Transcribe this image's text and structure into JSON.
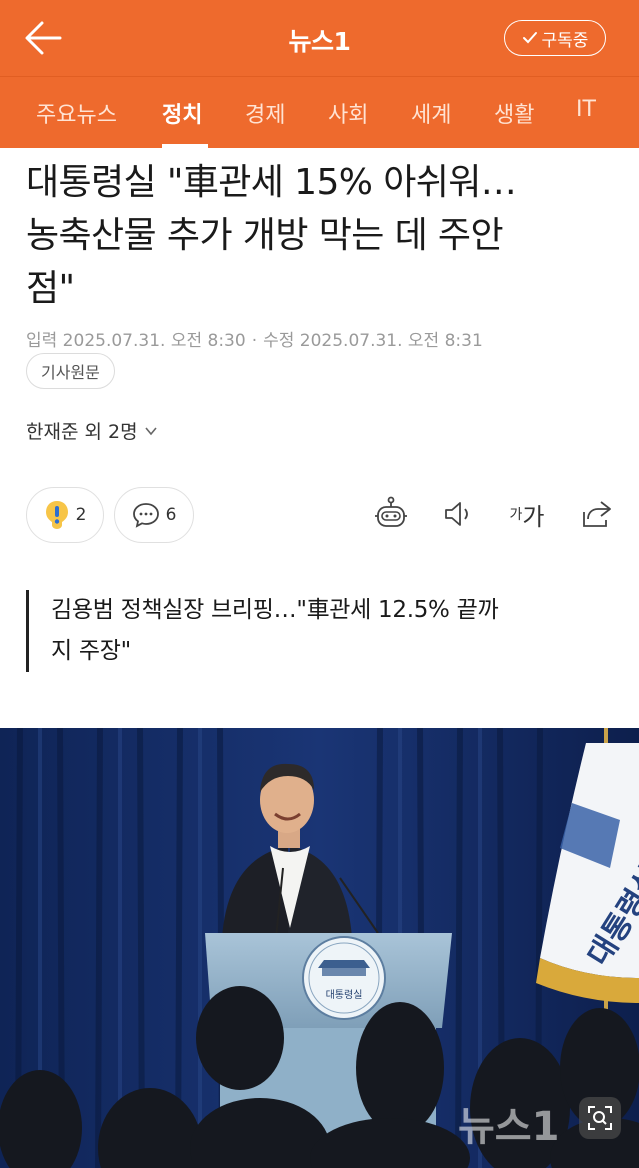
{
  "header": {
    "brand": "뉴스1",
    "subscribe_label": "구독중"
  },
  "tabs": [
    {
      "label": "주요뉴스",
      "active": false
    },
    {
      "label": "정치",
      "active": true
    },
    {
      "label": "경제",
      "active": false
    },
    {
      "label": "사회",
      "active": false
    },
    {
      "label": "세계",
      "active": false
    },
    {
      "label": "생활",
      "active": false
    },
    {
      "label": "IT",
      "active": false
    }
  ],
  "article": {
    "headline_lines": [
      "대통령실 \"車관세 15% 아쉬워…",
      "농축산물 추가 개방 막는 데 주안",
      "점\""
    ],
    "published": "입력 2025.07.31. 오전 8:30",
    "modified": "수정 2025.07.31. 오전 8:31",
    "original_button": "기사원문",
    "author": "한재준 외 2명",
    "reaction_count": "2",
    "comment_count": "6",
    "font_icon_small": "가",
    "font_icon_large": "가",
    "subtitle_lines": [
      "김용범 정책실장 브리핑…\"車관세 12.5% 끝까",
      "지 주장\""
    ]
  },
  "photo": {
    "seal_text": "대통령실",
    "flag_text": "대통령실",
    "watermark": "뉴스1"
  },
  "colors": {
    "brand_orange": "#ee6a2d",
    "text_dark": "#1a1a1a",
    "meta_gray": "#9a9a9a"
  }
}
